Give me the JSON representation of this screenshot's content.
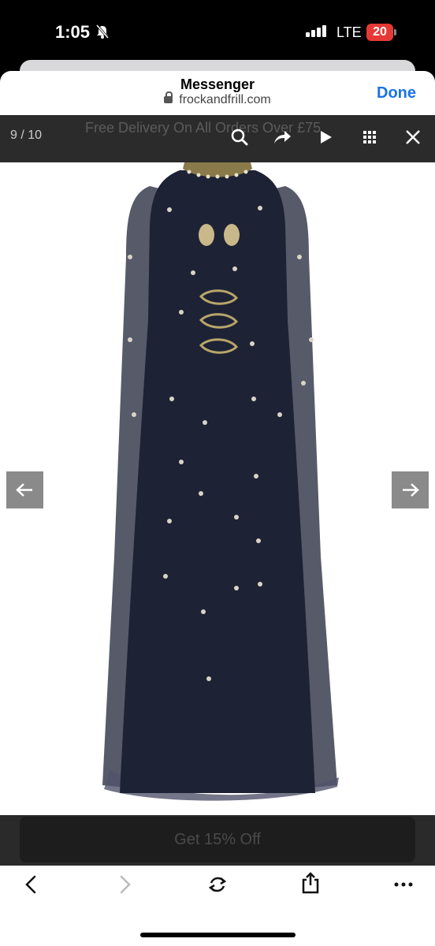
{
  "status_bar": {
    "time": "1:05",
    "network": "LTE",
    "battery": "20"
  },
  "browser": {
    "app_title": "Messenger",
    "domain": "frockandfrill.com",
    "done_label": "Done"
  },
  "gallery": {
    "counter": "9 / 10",
    "promo_text": "Free Delivery On All Orders Over £75",
    "icons": [
      "search-icon",
      "share-icon",
      "play-icon",
      "grid-icon",
      "close-icon"
    ]
  },
  "banner": {
    "cta_label": "Get 15% Off"
  },
  "bottom_nav": {
    "icons": [
      "back-icon",
      "forward-icon",
      "reload-icon",
      "share-icon",
      "more-icon"
    ]
  },
  "colors": {
    "accent": "#1a73e8",
    "battery": "#e53935",
    "dress": "#1e2235"
  }
}
